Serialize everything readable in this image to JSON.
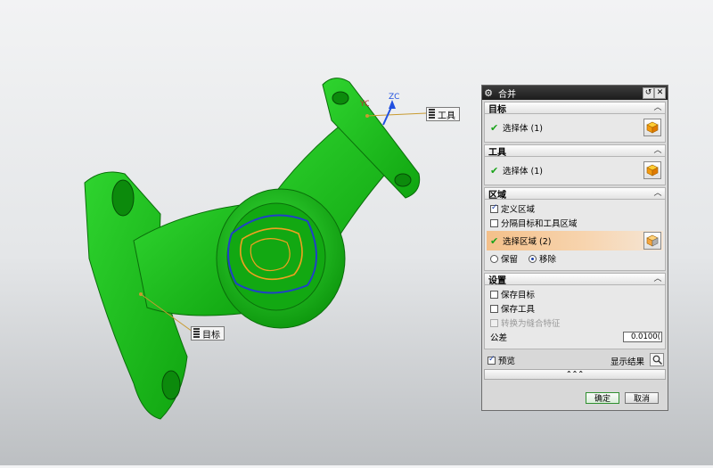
{
  "viewport": {
    "axis_label": "ZC",
    "axis_label_partial": "YC",
    "tool_callout": "工具",
    "target_callout": "目标"
  },
  "dialog": {
    "title": "合并",
    "title_buttons": [
      "reset",
      "close"
    ],
    "sections": {
      "target": {
        "header": "目标",
        "select_label": "选择体 (1)"
      },
      "tool": {
        "header": "工具",
        "select_label": "选择体 (1)"
      },
      "region": {
        "header": "区域",
        "define_region_label": "定义区域",
        "define_region_checked": true,
        "separate_label": "分隔目标和工具区域",
        "separate_checked": false,
        "select_region_label": "选择区域 (2)",
        "keep_label": "保留",
        "remove_label": "移除",
        "selected_option": "移除"
      },
      "settings": {
        "header": "设置",
        "keep_target_label": "保存目标",
        "keep_target_checked": false,
        "keep_tool_label": "保存工具",
        "keep_tool_checked": false,
        "convert_label": "转换为缝合特征",
        "convert_checked": false,
        "tolerance_label": "公差",
        "tolerance_value": "0.0100("
      }
    },
    "preview_label": "预览",
    "preview_checked": true,
    "show_result_label": "显示结果",
    "more_label": "⌃⌃⌃",
    "ok_label": "确定",
    "cancel_label": "取消"
  },
  "colors": {
    "part_green": "#1fbe1f",
    "highlight_orange": "#f4c08a",
    "ok_border": "#2f8f2f"
  }
}
